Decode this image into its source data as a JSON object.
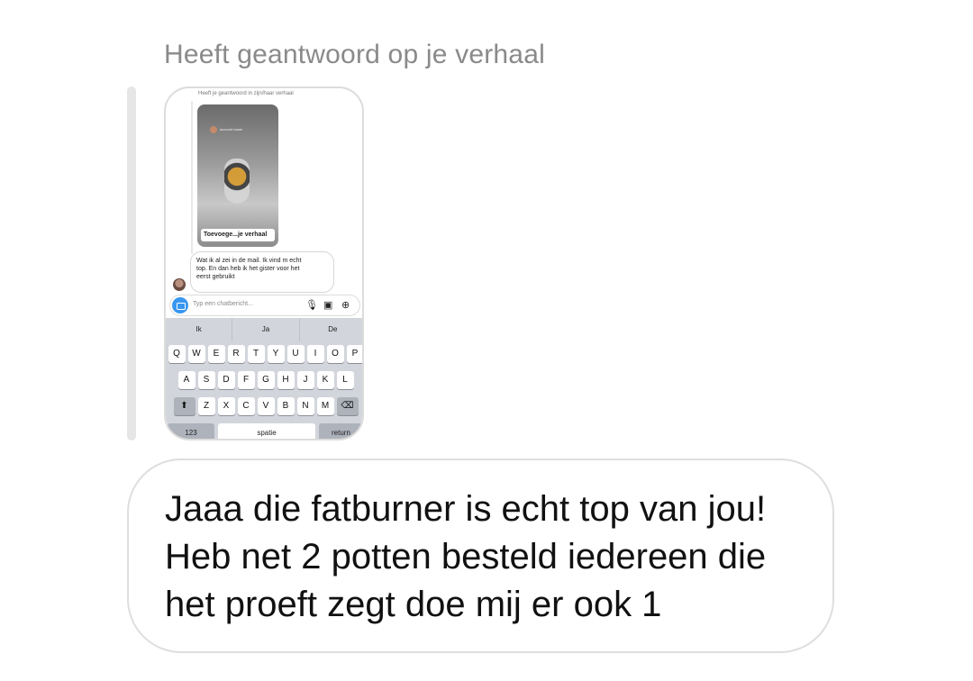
{
  "header": {
    "reply_label": "Heeft geantwoord op je verhaal"
  },
  "story_preview": {
    "top_text": "Heeft je geantwoord in zijn/haar verhaal",
    "shared_story_author": "account naam",
    "shared_story_caption": "Toevoege...je verhaal",
    "message_lines": [
      "Wat ik al zei in de mail. Ik vind m echt",
      "top. En dan heb ik het gister voor het",
      "eerst gebruikt"
    ],
    "input_placeholder": "Typ een chatbericht...",
    "input_icons": [
      "camera-icon",
      "microphone-icon",
      "gallery-icon",
      "plus-icon"
    ],
    "keyboard": {
      "suggestions": [
        "Ik",
        "Ja",
        "De"
      ],
      "row1": [
        "Q",
        "W",
        "E",
        "R",
        "T",
        "Y",
        "U",
        "I",
        "O",
        "P"
      ],
      "row2": [
        "A",
        "S",
        "D",
        "F",
        "G",
        "H",
        "J",
        "K",
        "L"
      ],
      "row3": [
        "Z",
        "X",
        "C",
        "V",
        "B",
        "N",
        "M"
      ],
      "numbers_key": "123",
      "space_key": "spatie",
      "return_key": "return"
    }
  },
  "reply_message": {
    "lines": [
      "Jaaa die fatburner is echt top van jou!",
      "Heb net 2 potten besteld iedereen die",
      "het proeft zegt doe mij er ook 1"
    ]
  }
}
